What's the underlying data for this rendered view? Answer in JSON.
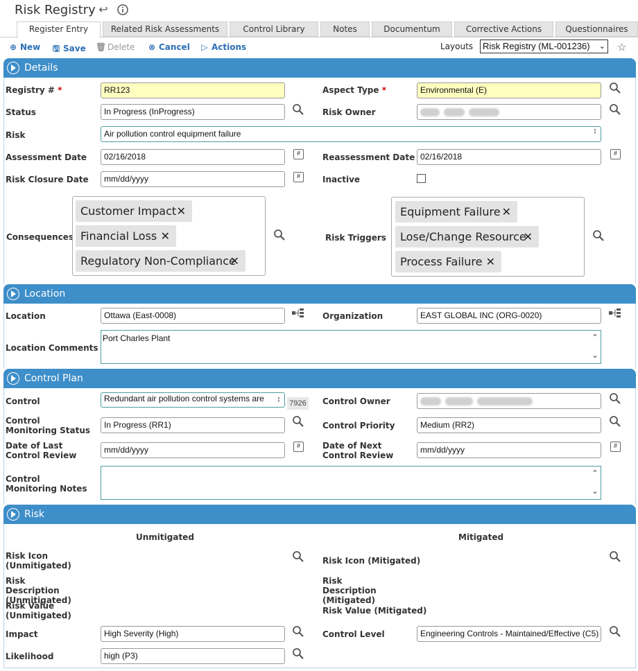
{
  "title": "Risk Registry",
  "tabs": [
    "Register Entry",
    "Related Risk Assessments",
    "Control Library",
    "Notes",
    "Documentum",
    "Corrective Actions",
    "Questionnaires"
  ],
  "toolbar": {
    "new": "New",
    "save": "Save",
    "delete": "Delete",
    "cancel": "Cancel",
    "actions": "Actions",
    "layouts_label": "Layouts",
    "layouts_value": "Risk Registry (ML-001236)"
  },
  "details": {
    "header": "Details",
    "registry_label": "Registry #",
    "registry_value": "RR123",
    "aspect_label": "Aspect Type",
    "aspect_value": "Environmental (E)",
    "status_label": "Status",
    "status_value": "In Progress (InProgress)",
    "owner_label": "Risk Owner",
    "risk_label": "Risk",
    "risk_value": "Air pollution control equipment failure",
    "assess_label": "Assessment Date",
    "assess_value": "02/16/2018",
    "reassess_label": "Reassessment Date",
    "reassess_value": "02/16/2018",
    "closure_label": "Risk Closure Date",
    "closure_value": "mm/dd/yyyy",
    "inactive_label": "Inactive",
    "consequences_label": "Consequences",
    "consequences": [
      "Customer Impact",
      "Financial Loss",
      "Regulatory Non-Compliance"
    ],
    "triggers_label": "Risk Triggers",
    "triggers": [
      "Equipment Failure",
      "Lose/Change Resource",
      "Process Failure"
    ]
  },
  "location": {
    "header": "Location",
    "location_label": "Location",
    "location_value": "Ottawa (East-0008)",
    "org_label": "Organization",
    "org_value": "EAST GLOBAL INC (ORG-0020)",
    "comments_label": "Location Comments",
    "comments_value": "Port Charles Plant"
  },
  "control_plan": {
    "header": "Control Plan",
    "control_label": "Control",
    "control_value": "Redundant air pollution control systems are",
    "control_counter": "7926",
    "owner_label": "Control Owner",
    "mon_status_label": "Control Monitoring Status",
    "mon_status_value": "In Progress (RR1)",
    "priority_label": "Control Priority",
    "priority_value": "Medium (RR2)",
    "last_review_label": "Date of Last Control Review",
    "last_review_value": "mm/dd/yyyy",
    "next_review_label": "Date of Next Control Review",
    "next_review_value": "mm/dd/yyyy",
    "notes_label": "Control Monitoring Notes"
  },
  "risk": {
    "header": "Risk",
    "unmitigated": "Unmitigated",
    "mitigated": "Mitigated",
    "icon_unmit": "Risk Icon (Unmitigated)",
    "icon_mit": "Risk Icon (Mitigated)",
    "desc_unmit": "Risk Description (Unmitigated)",
    "desc_mit": "Risk Description (Mitigated)",
    "value_unmit": "Risk Value (Unmitigated)",
    "value_mit": "Risk Value (Mitigated)",
    "impact_label": "Impact",
    "impact_value": "High Severity (High)",
    "control_level_label": "Control Level",
    "control_level_value": "Engineering Controls - Maintained/Effective (C5)",
    "likelihood_label": "Likelihood",
    "likelihood_value": "high (P3)"
  },
  "colors": {
    "accent": "#3d8ec9",
    "required_bg": "#ffffc0",
    "link": "#2c6fb5"
  }
}
